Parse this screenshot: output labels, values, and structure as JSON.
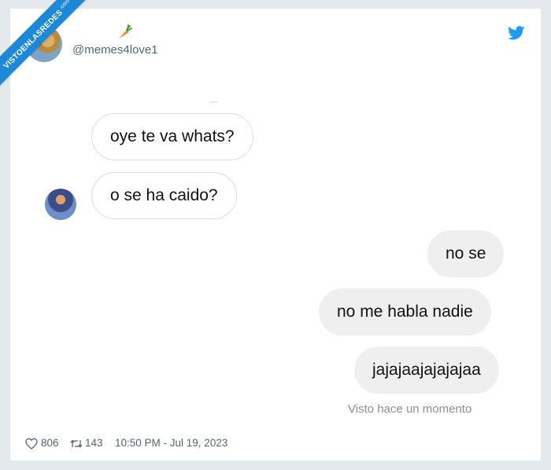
{
  "watermark": {
    "text": "VISTOENLASREDES",
    "suffix": ".com"
  },
  "user": {
    "handle": "@memes4love1",
    "emoji_icon": "carrot-icon"
  },
  "brand": {
    "icon": "twitter-bird-icon",
    "color": "#1d9bf0"
  },
  "chat": {
    "incoming": [
      "oye te va whats?",
      "o se ha caido?"
    ],
    "outgoing": [
      "no se",
      "no me habla nadie",
      "jajajaajajajajaa"
    ],
    "seen_status": "Visto hace un momento"
  },
  "footer": {
    "likes": "806",
    "retweets": "143",
    "timestamp": "10:50 PM - Jul 19, 2023"
  }
}
